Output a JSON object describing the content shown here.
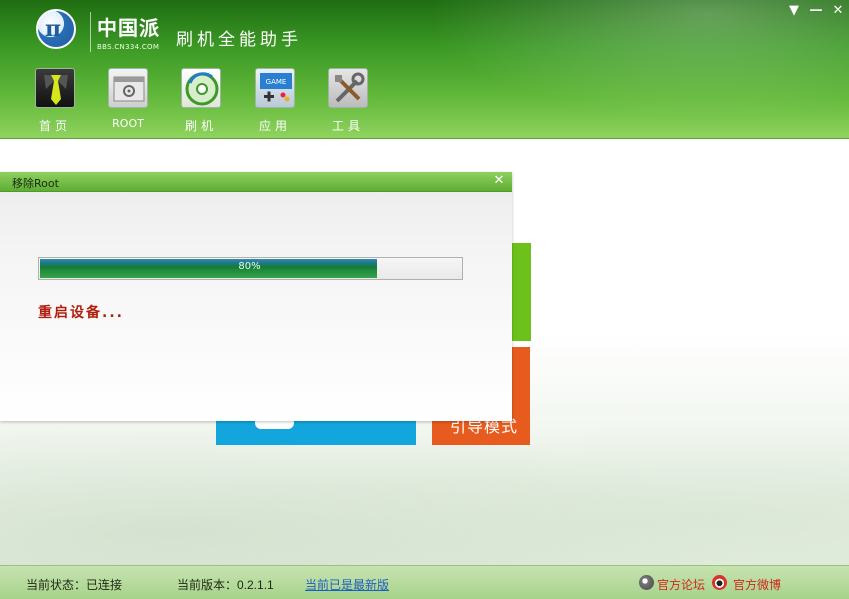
{
  "header": {
    "brand_cn": "中国派",
    "brand_en": "BBS.CN334.COM",
    "app_title": "刷机全能助手",
    "menu_btn": "▼",
    "min_btn": "—",
    "close_btn": "✕",
    "nav": [
      {
        "label": "首页",
        "icon": "tie-icon"
      },
      {
        "label": "ROOT",
        "icon": "settings-icon"
      },
      {
        "label": "刷机",
        "icon": "disc-icon"
      },
      {
        "label": "应用",
        "icon": "game-icon"
      },
      {
        "label": "工具",
        "icon": "tools-icon"
      }
    ],
    "game_icon_text": "GAME"
  },
  "tiles": {
    "orange_label": "引导模式"
  },
  "dialog": {
    "title": "移除Root",
    "close": "✕",
    "progress_percent": 80,
    "progress_label": "80%",
    "status": "重启设备..."
  },
  "footer": {
    "connection": "当前状态：已连接",
    "version": "当前版本：0.2.1.1",
    "update": "当前已是最新版",
    "forum": "官方论坛",
    "weibo": "官方微博"
  },
  "colors": {
    "header_green": "#3c9a25",
    "tile_green": "#6cc21b",
    "tile_orange": "#e75c1e",
    "tile_blue": "#12a6dc",
    "status_red": "#b01e0e"
  }
}
